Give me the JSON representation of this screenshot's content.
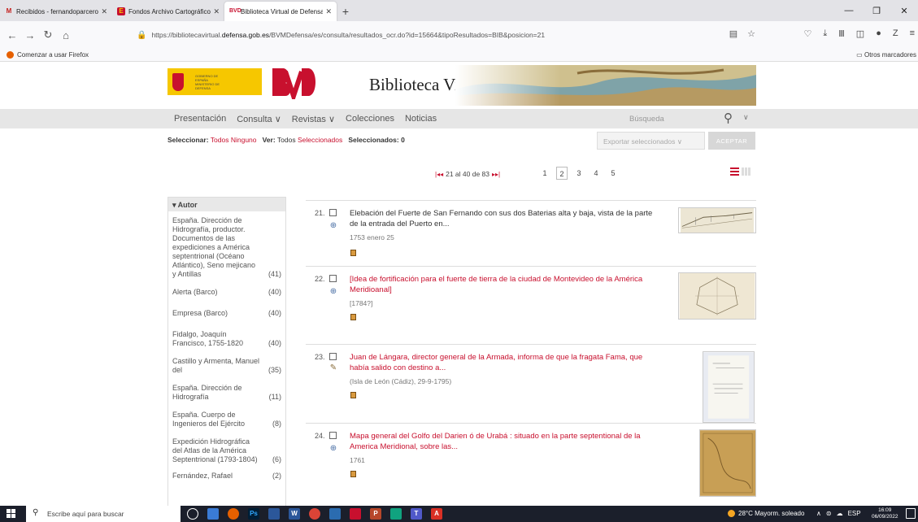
{
  "browser": {
    "tabs": [
      {
        "label": "Recibidos - fernandoparceroco",
        "favicon": "gmail-icon",
        "active": false
      },
      {
        "label": "Fondos Archivo Cartográfico y",
        "favicon": "archive-icon",
        "active": false
      },
      {
        "label": "Biblioteca Virtual de Defensa >",
        "favicon": "bvd-icon",
        "active": true
      }
    ],
    "new_tab": "+",
    "url_prefix": "https://bibliotecavirtual.",
    "url_host": "defensa.gob.es",
    "url_path": "/BVMDefensa/es/consulta/resultados_ocr.do?id=15664&tipoResultados=BIB&posicion=21",
    "bookmark_firefox": "Comenzar a usar Firefox",
    "bookmark_other": "Otros marcadores"
  },
  "header": {
    "title": "Biblioteca Virtual de Defensa",
    "gob_text": "GOBIERNO DE ESPAÑA  MINISTERIO DE DEFENSA"
  },
  "nav": {
    "items": [
      "Presentación",
      "Consulta ∨",
      "Revistas ∨",
      "Colecciones",
      "Noticias"
    ],
    "search_placeholder": "Búsqueda"
  },
  "selection": {
    "select_label": "Seleccionar:",
    "todos": "Todos",
    "ninguno": "Ninguno",
    "ver_label": "Ver:",
    "ver_todos": "Todos",
    "seleccionados": "Seleccionados",
    "count_label": "Seleccionados: 0",
    "export_label": "Exportar seleccionados",
    "accept_label": "ACEPTAR"
  },
  "pagination": {
    "range": "21 al 40 de 83",
    "pages": [
      "1",
      "2",
      "3",
      "4",
      "5"
    ],
    "current": "2"
  },
  "facets": {
    "heading": "▾ Autor",
    "items": [
      {
        "name": "España. Dirección de Hidrografía, productor. Documentos de las expediciones a América septentrional (Océano Atlántico), Seno mejicano y Antillas",
        "count": "(41)"
      },
      {
        "name": "Alerta (Barco)",
        "count": "(40)"
      },
      {
        "name": "Empresa (Barco)",
        "count": "(40)"
      },
      {
        "name": "Fidalgo, Joaquín Francisco, 1755-1820",
        "count": "(40)"
      },
      {
        "name": "Castillo y Armenta, Manuel del",
        "count": "(35)"
      },
      {
        "name": "España. Dirección de Hidrografía",
        "count": "(11)"
      },
      {
        "name": "España. Cuerpo de Ingenieros del Ejército",
        "count": "(8)"
      },
      {
        "name": "Expedición Hidrográfica del Atlas de la América Septentrional (1793-1804)",
        "count": "(6)"
      },
      {
        "name": "Fernández, Rafael",
        "count": "(2)"
      }
    ]
  },
  "results": [
    {
      "num": "21.",
      "title": "Elebación del Fuerte de San Fernando con sus dos Baterias alta y baja, vista de la parte de la entrada del Puerto en...",
      "date": "1753 enero 25",
      "style": "plain",
      "type_icon": "map-icon"
    },
    {
      "num": "22.",
      "title": "[Idea de fortificación para el fuerte de tierra de la ciudad de Montevideo de la América Meridioanal]",
      "date": "[1784?]",
      "style": "red",
      "type_icon": "map-icon"
    },
    {
      "num": "23.",
      "title": "Juan de Lángara, director general de la Armada, informa de que la fragata Fama, que había salido con destino a...",
      "date": "(Isla de León (Cádiz), 29-9-1795)",
      "style": "red",
      "type_icon": "manuscript-icon"
    },
    {
      "num": "24.",
      "title": "Mapa general del Golfo del Darien ó de Urabá : situado en la parte septentional de la America Meridional, sobre las...",
      "date": "1761",
      "style": "red",
      "type_icon": "map-icon"
    }
  ],
  "taskbar": {
    "search": "Escribe aquí para buscar",
    "weather": "28°C  Mayorm. soleado",
    "lang": "ESP",
    "time": "16:09",
    "date": "06/09/2022"
  },
  "colors": {
    "accent": "#c8102e",
    "nav_bg": "#e6e6e6",
    "taskbar": "#1b1f2b"
  }
}
